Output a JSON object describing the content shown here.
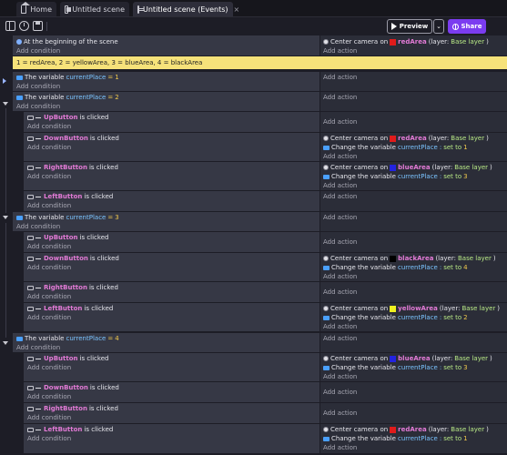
{
  "tabs": [
    {
      "label": "Home",
      "icon": "home-icon"
    },
    {
      "label": "Untitled scene",
      "icon": "scene-icon"
    },
    {
      "label": "Untitled scene (Events)",
      "icon": "events-icon"
    }
  ],
  "toolbar": {
    "preview_label": "Preview",
    "share_label": "Share",
    "share_color": "#7b3cf0"
  },
  "common": {
    "add_condition": "Add condition",
    "add_action": "Add action",
    "is_clicked": "is clicked",
    "layer_prefix": "(layer: ",
    "layer_name": "Base layer",
    "layer_suffix": ")"
  },
  "events": {
    "start": {
      "condition": "At the beginning of the scene",
      "action_text": "Center camera on",
      "object": "redArea"
    },
    "comment": "1 = redArea, 2 = yellowArea, 3 = blueArea, 4 = blackArea",
    "var1": {
      "text": "The variable",
      "var": "currentPlace",
      "op": "=",
      "value": "1"
    },
    "var2": {
      "text": "The variable",
      "var": "currentPlace",
      "op": "=",
      "value": "2"
    },
    "var3": {
      "text": "The variable",
      "var": "currentPlace",
      "op": "=",
      "value": "3"
    },
    "var4": {
      "text": "The variable",
      "var": "currentPlace",
      "op": "=",
      "value": "4"
    },
    "buttons": {
      "up": "UpButton",
      "down": "DownButton",
      "right": "RightButton",
      "left": "LeftButton"
    },
    "camera_text": "Center camera on",
    "change_text": "Change the variable",
    "set_to": "set to",
    "areas": {
      "red": "redArea",
      "blue": "blueArea",
      "black": "blackArea",
      "yellow": "yellowArea"
    },
    "colors": {
      "red": "#e01b1b",
      "blue": "#2323e0",
      "black": "#000000",
      "yellow": "#f0f020"
    }
  },
  "values": {
    "v1": "1",
    "v2": "2",
    "v3": "3",
    "v4": "4",
    "colon": ":"
  }
}
